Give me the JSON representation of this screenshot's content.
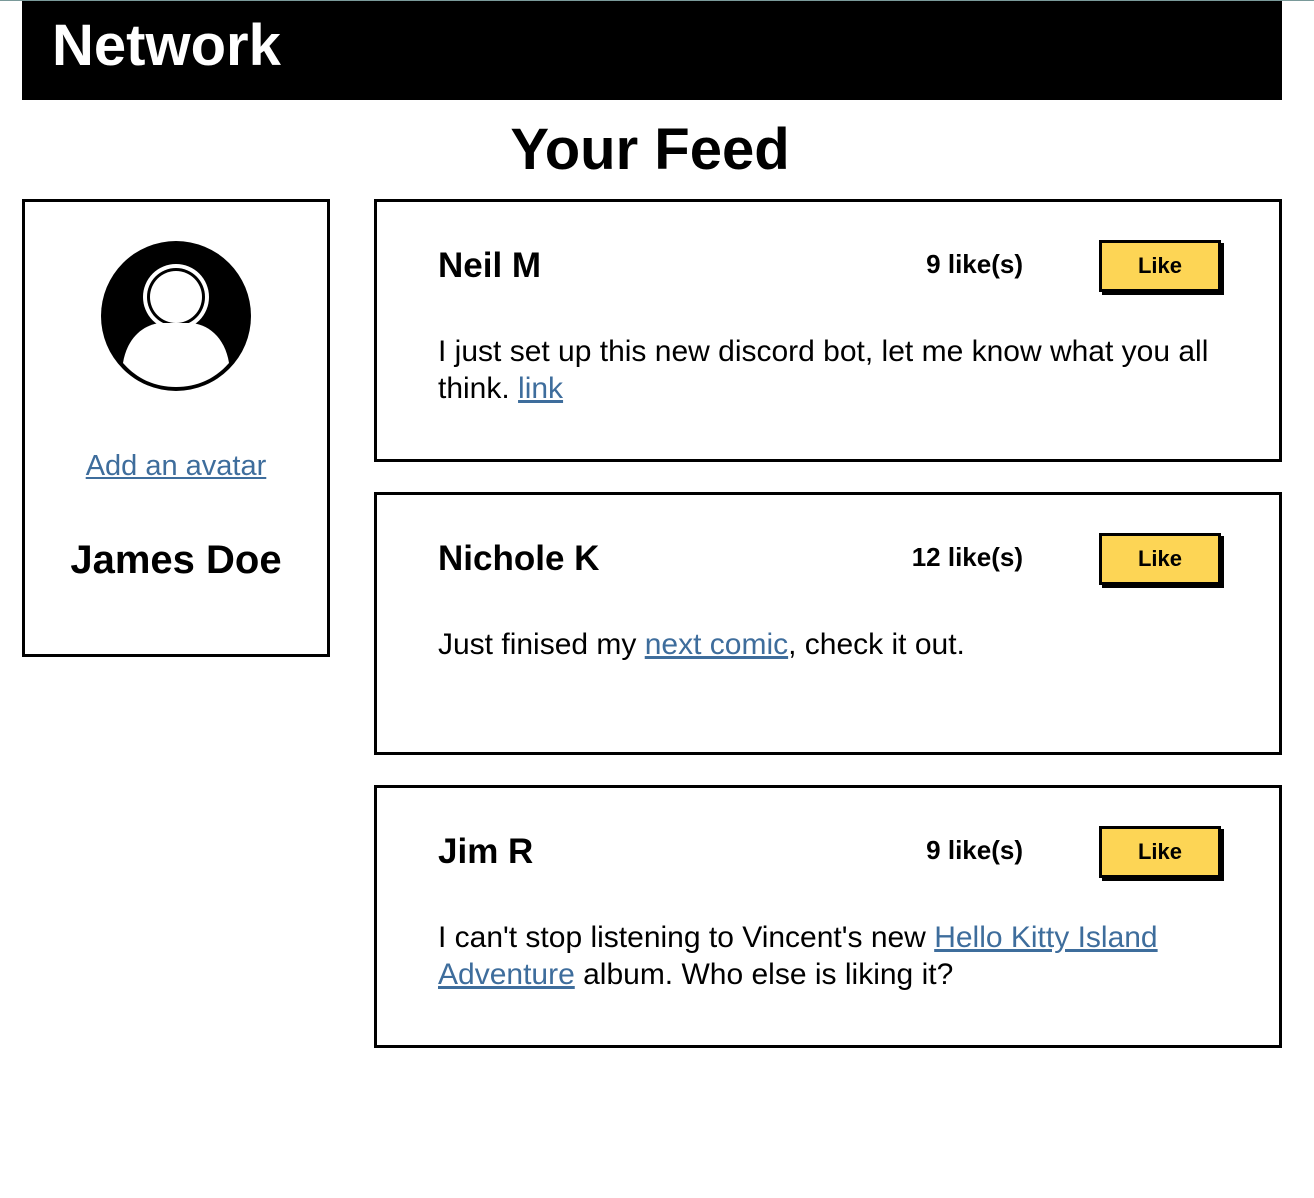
{
  "header": {
    "brand": "Network"
  },
  "page": {
    "title": "Your Feed"
  },
  "profile": {
    "avatar_icon": "user-circle-icon",
    "add_avatar_label": "Add an avatar",
    "name": "James Doe"
  },
  "posts": [
    {
      "author": "Neil M",
      "likes": "9 like(s)",
      "like_label": "Like",
      "text_before": "I just set up this new discord bot, let me know what you all think. ",
      "link_text": "link",
      "text_after": ""
    },
    {
      "author": "Nichole K",
      "likes": "12 like(s)",
      "like_label": "Like",
      "text_before": "Just finised my ",
      "link_text": "next comic",
      "text_after": ", check it out."
    },
    {
      "author": "Jim R",
      "likes": "9 like(s)",
      "like_label": "Like",
      "text_before": "I can't stop listening to Vincent's new ",
      "link_text": "Hello Kitty Island Adventure",
      "text_after": " album. Who else is liking it?"
    }
  ],
  "colors": {
    "header_bg": "#000000",
    "like_button": "#fdd555",
    "link": "#3e6d9c"
  }
}
